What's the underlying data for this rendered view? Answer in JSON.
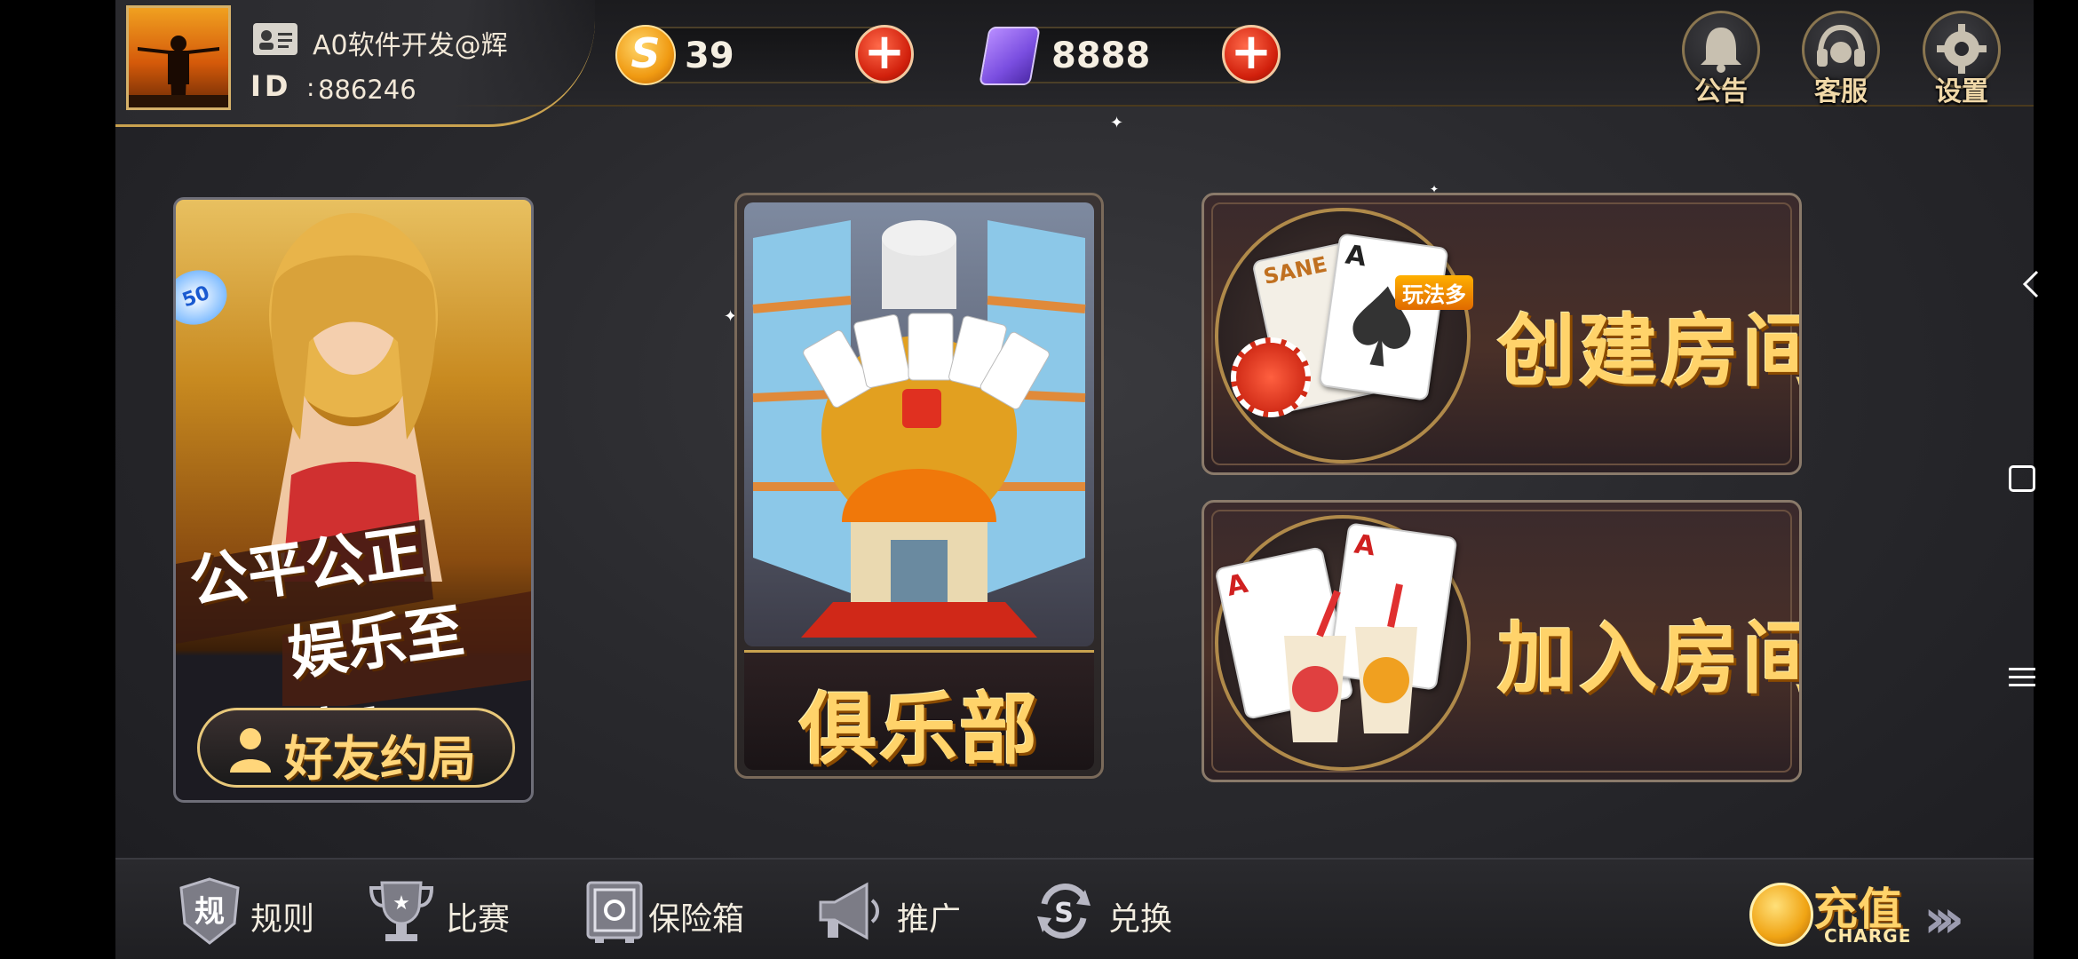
{
  "profile": {
    "username": "A0软件开发@辉",
    "id_label": "ID",
    "id_colon": ":",
    "id_value": "886246"
  },
  "currencies": [
    {
      "name": "coins",
      "value": "39",
      "icon": "gold-coin-icon"
    },
    {
      "name": "room-cards",
      "value": "8888",
      "icon": "room-card-icon"
    }
  ],
  "top_buttons": [
    {
      "label": "公告",
      "icon": "bell-icon"
    },
    {
      "label": "客服",
      "icon": "headset-icon"
    },
    {
      "label": "设置",
      "icon": "gear-icon"
    }
  ],
  "promo": {
    "line1": "公平公正",
    "line2": "娱乐至上!",
    "chip_text": "50",
    "button_label": "好友约局"
  },
  "club": {
    "label": "俱乐部"
  },
  "rooms": {
    "create_label": "创建房间",
    "create_badge": "玩法多",
    "card_brand": "SANE",
    "join_label": "加入房间",
    "card_rank": "A"
  },
  "bottom_nav": [
    {
      "label": "规则",
      "icon": "rules-shield-icon"
    },
    {
      "label": "比赛",
      "icon": "trophy-icon"
    },
    {
      "label": "保险箱",
      "icon": "safe-icon"
    },
    {
      "label": "推广",
      "icon": "megaphone-icon"
    },
    {
      "label": "兑换",
      "icon": "exchange-icon"
    }
  ],
  "charge": {
    "label": "充值",
    "sublabel": "CHARGE",
    "arrows": "›››"
  },
  "colors": {
    "gold": "#ffd36a",
    "accent_red": "#d1200c",
    "background": "#2a2a2e"
  }
}
